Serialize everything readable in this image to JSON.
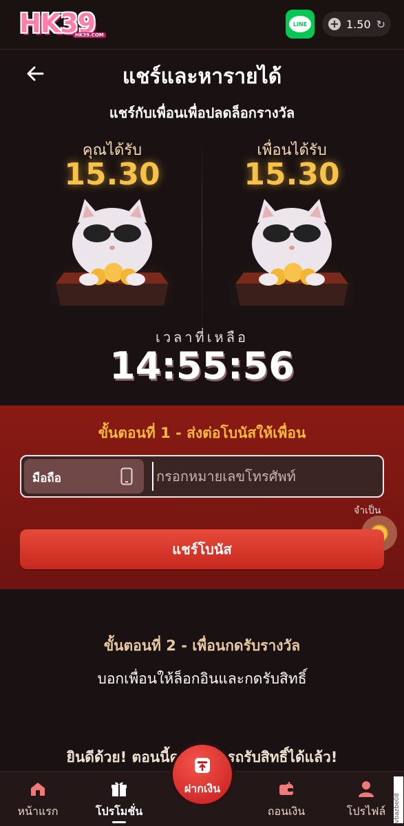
{
  "header": {
    "logo_text": "HK39",
    "logo_sub": "HK39.COM",
    "line_label": "LINE",
    "balance": "1.50"
  },
  "hero": {
    "title": "แชร์และหารายได้",
    "subtitle": "แชร์กับเพื่อนเพื่อปลดล็อกรางวัล",
    "you_label": "คุณได้รับ",
    "you_amount": "15.30",
    "friend_label": "เพื่อนได้รับ",
    "friend_amount": "15.30",
    "timer_label": "เวลาที่เหลือ",
    "timer": "14:55:56"
  },
  "step1": {
    "title": "ขั้นตอนที่ 1 - ส่งต่อโบนัสให้เพื่อน",
    "phone_label": "มือถือ",
    "phone_placeholder": "กรอกหมายเลขโทรศัพท์",
    "required_note": "จำเป็น",
    "share_button": "แชร์โบนัส"
  },
  "step2": {
    "title": "ขั้นตอนที่ 2 - เพื่อนกดรับรางวัล",
    "description": "บอกเพื่อนให้ล็อกอินและกดรับสิทธิ์",
    "congrats": "ยินดีด้วย! ตอนนี้คุณสามารถรับสิทธิ์ได้แล้ว!"
  },
  "nav": {
    "home": "หน้าแรก",
    "promotions": "โปรโมชั่น",
    "deposit": "ฝากเงิน",
    "withdraw": "ถอนเงิน",
    "profile": "โปรไฟล์"
  },
  "side_id": "vbazbe08",
  "colors": {
    "accent_gold": "#f6c24a",
    "panel_red": "#8a1a14",
    "button_red": "#e74a3a",
    "line_green": "#06c755"
  }
}
